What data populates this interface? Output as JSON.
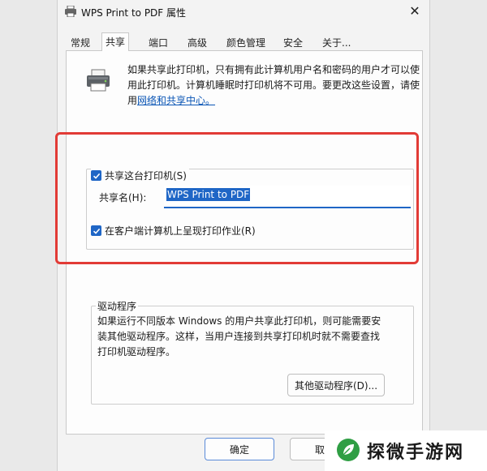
{
  "window": {
    "title": "WPS Print to PDF 属性"
  },
  "tabs": [
    {
      "label": "常规"
    },
    {
      "label": "共享"
    },
    {
      "label": "端口"
    },
    {
      "label": "高级"
    },
    {
      "label": "颜色管理"
    },
    {
      "label": "安全"
    },
    {
      "label": "关于..."
    }
  ],
  "description": {
    "line1": "如果共享此打印机，只有拥有此计算机用户名和密码的用户才可以使",
    "line2": "用此打印机。计算机睡眠时打印机将不可用。要更改这些设置，请使",
    "line3_prefix": "用",
    "link": "网络和共享中心。"
  },
  "share_checkbox": {
    "label": "共享这台打印机(S)",
    "checked": true
  },
  "share_name": {
    "label": "共享名(H):",
    "value": "WPS Print to PDF"
  },
  "render_checkbox": {
    "label": "在客户端计算机上呈现打印作业(R)",
    "checked": true
  },
  "drivers": {
    "legend": "驱动程序",
    "line1": "如果运行不同版本 Windows 的用户共享此打印机，则可能需要安",
    "line2": "装其他驱动程序。这样，当用户连接到共享打印机时就不需要查找",
    "line3": "打印机驱动程序。",
    "button": "其他驱动程序(D)..."
  },
  "footer": {
    "ok": "确定",
    "cancel": "取消"
  },
  "brand": {
    "text": "探微手游网"
  },
  "colors": {
    "accent": "#1f66c6",
    "highlight_frame": "#e23b36"
  }
}
